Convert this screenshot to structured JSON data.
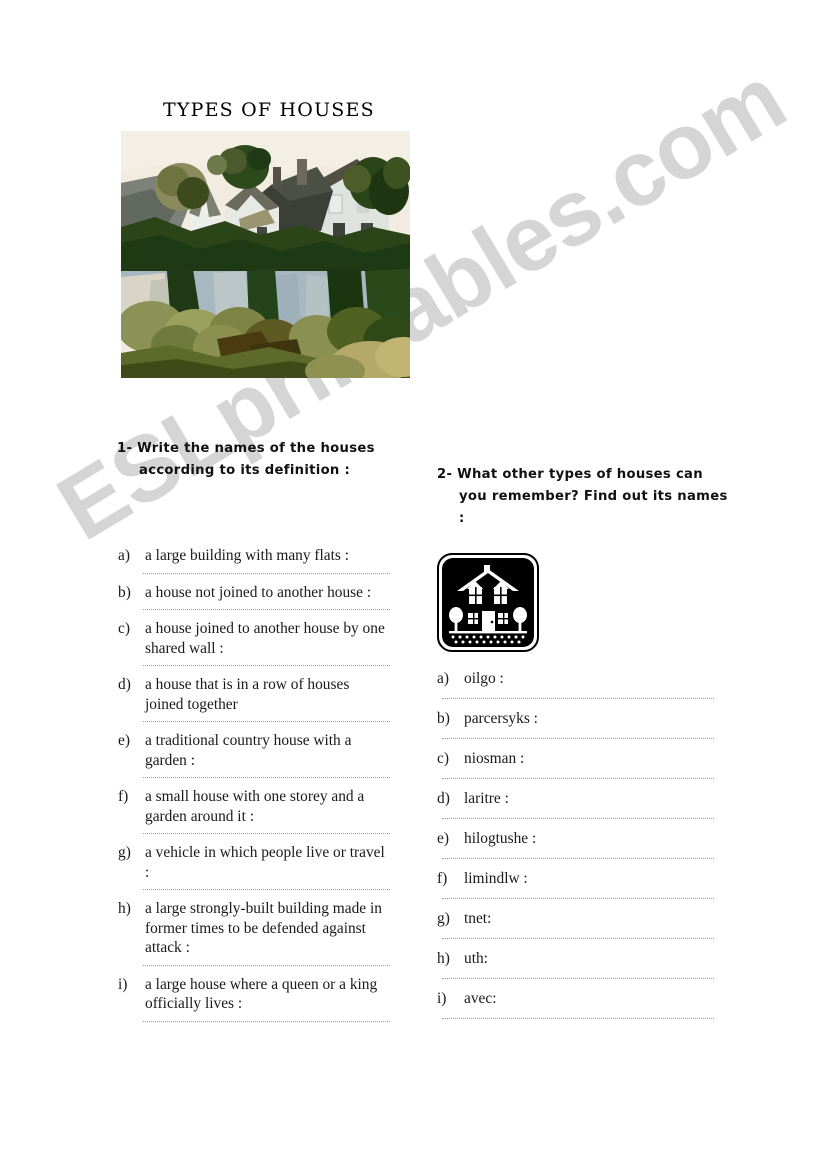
{
  "worksheet": {
    "title": "TYPES OF HOUSES",
    "watermark": "ESLprintables.com"
  },
  "exercise1": {
    "heading": "1- Write the names of the houses according to its definition :",
    "items": [
      {
        "letter": "a)",
        "text": "a large building with many flats :"
      },
      {
        "letter": "b)",
        "text": "a house not joined to another house :"
      },
      {
        "letter": "c)",
        "text": "a house joined to another house by one shared wall :"
      },
      {
        "letter": "d)",
        "text": "a house that is in a row of houses joined together"
      },
      {
        "letter": "e)",
        "text": "a traditional country house with a garden :"
      },
      {
        "letter": "f)",
        "text": "a small house with one storey and a garden around it :"
      },
      {
        "letter": "g)",
        "text": "a vehicle in which people live or travel :"
      },
      {
        "letter": "h)",
        "text": "a large strongly-built building made in former times to be defended against attack :"
      },
      {
        "letter": "i)",
        "text": "a large house where a queen or a king officially lives :"
      }
    ]
  },
  "exercise2": {
    "heading": "2- What other types of houses can you remember? Find out its names :",
    "icon": "house-icon",
    "items": [
      {
        "letter": "a)",
        "text": "oilgo :"
      },
      {
        "letter": "b)",
        "text": " parcersyks :"
      },
      {
        "letter": "c)",
        "text": "niosman :"
      },
      {
        "letter": "d)",
        "text": "laritre :"
      },
      {
        "letter": "e)",
        "text": "hilogtushe :"
      },
      {
        "letter": "f)",
        "text": "limindlw :"
      },
      {
        "letter": "g)",
        "text": "tnet:"
      },
      {
        "letter": "h)",
        "text": "uth:"
      },
      {
        "letter": "i)",
        "text": "avec:"
      }
    ]
  },
  "photo": {
    "name": "cottages-by-river-painting",
    "colors": {
      "sky": "#f2ece0",
      "house_wall": "#e8ebe6",
      "roof_dark": "#3b3f38",
      "roof_light": "#8f8a76",
      "foliage_dark": "#1d3a14",
      "foliage_mid": "#4a5a22",
      "foliage_olive": "#8e9152",
      "water": "#a8b8c0",
      "ground": "#b5a868"
    }
  }
}
